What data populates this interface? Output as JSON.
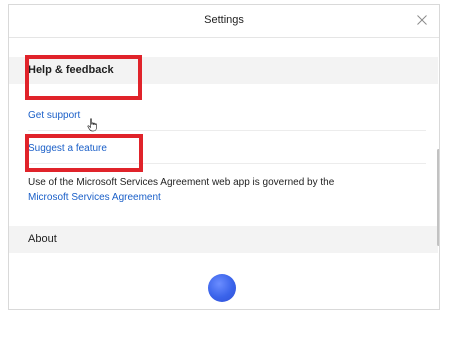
{
  "dialog": {
    "title": "Settings",
    "close_icon": "close-icon"
  },
  "help_section": {
    "title": "Help & feedback",
    "links": {
      "get_support": "Get support",
      "suggest_feature": "Suggest a feature"
    },
    "agreement_text": "Use of the Microsoft Services Agreement web app is governed by the",
    "agreement_link": "Microsoft Services Agreement"
  },
  "about_section": {
    "title": "About"
  },
  "loading_indicator": "spinner-icon",
  "annotation_color": "#e0232a",
  "link_color": "#1a5fc8"
}
